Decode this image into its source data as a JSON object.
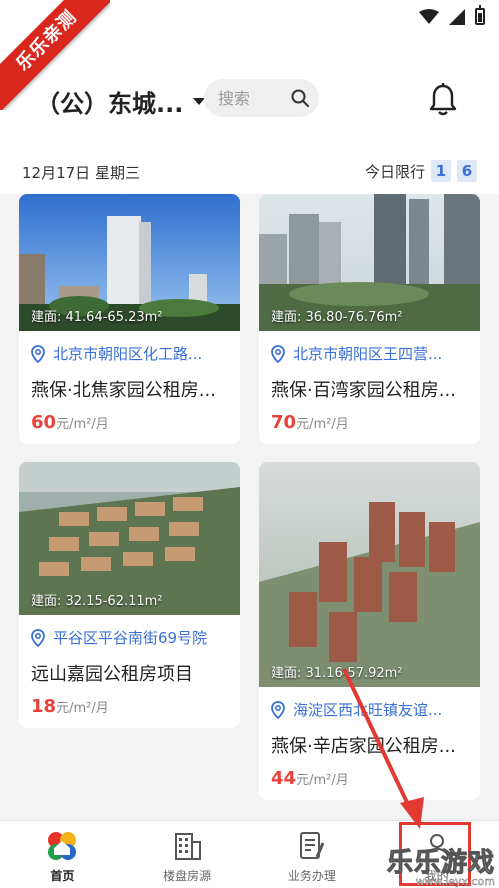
{
  "ribbon": {
    "text": "乐乐亲测"
  },
  "header": {
    "district": "（公）东城...",
    "search_placeholder": "搜索"
  },
  "date_row": {
    "date": "12月17日  星期三",
    "limit_label": "今日限行",
    "limit_numbers": [
      "1",
      "6"
    ]
  },
  "cards": [
    {
      "area": "建面: 41.64-65.23m²",
      "address": "北京市朝阳区化工路...",
      "title": "燕保·北焦家园公租房...",
      "price": "60",
      "unit": "元/m²/月"
    },
    {
      "area": "建面: 36.80-76.76m²",
      "address": "北京市朝阳区王四营...",
      "title": "燕保·百湾家园公租房...",
      "price": "70",
      "unit": "元/m²/月"
    },
    {
      "area": "建面: 32.15-62.11m²",
      "address": "平谷区平谷南街69号院",
      "title": "远山嘉园公租房项目",
      "price": "18",
      "unit": "元/m²/月"
    },
    {
      "area": "建面: 31.16-57.92m²",
      "address": "海淀区西北旺镇友谊...",
      "title": "燕保·辛店家园公租房...",
      "price": "44",
      "unit": "元/m²/月"
    }
  ],
  "nav": {
    "items": [
      {
        "label": "首页",
        "icon": "home-logo-icon"
      },
      {
        "label": "楼盘房源",
        "icon": "building-icon"
      },
      {
        "label": "业务办理",
        "icon": "document-pen-icon"
      },
      {
        "label": "我的",
        "icon": "user-icon"
      }
    ]
  },
  "watermark": {
    "main": "乐乐游戏",
    "sub": "www.leyx.com"
  },
  "colors": {
    "accent_blue": "#3a6fd6",
    "price_red": "#e8423a",
    "ribbon_red": "#d9271e"
  }
}
